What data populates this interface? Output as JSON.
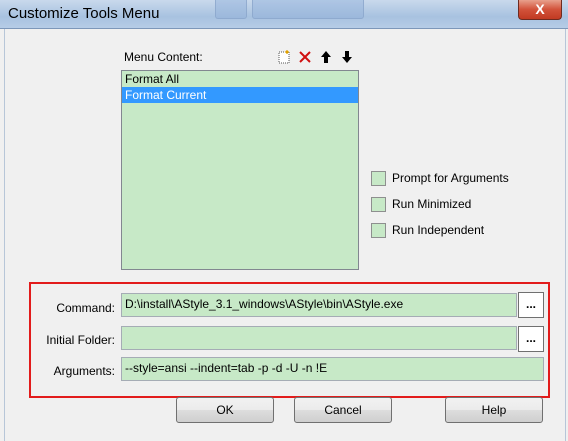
{
  "window": {
    "title": "Customize Tools Menu",
    "close_label": "X"
  },
  "menu_content": {
    "label": "Menu Content:",
    "toolbar_icons": [
      "new-item-icon",
      "delete-icon",
      "move-up-icon",
      "move-down-icon"
    ],
    "items": [
      {
        "label": "Format All",
        "selected": false
      },
      {
        "label": "Format Current",
        "selected": true
      }
    ]
  },
  "options": {
    "prompt": "Prompt for  Arguments",
    "minimized": "Run Minimized",
    "independent": "Run Independent"
  },
  "fields": {
    "command_label": "Command:",
    "command_value": "D:\\install\\AStyle_3.1_windows\\AStyle\\bin\\AStyle.exe",
    "folder_label": "Initial Folder:",
    "folder_value": "",
    "arguments_label": "Arguments:",
    "arguments_value": "--style=ansi --indent=tab -p -d -U -n !E",
    "browse_label": "..."
  },
  "buttons": {
    "ok": "OK",
    "cancel": "Cancel",
    "help": "Help"
  },
  "colors": {
    "field_bg": "#c7e9c7",
    "selection": "#3399ff",
    "highlight_frame": "#e21b1b"
  }
}
